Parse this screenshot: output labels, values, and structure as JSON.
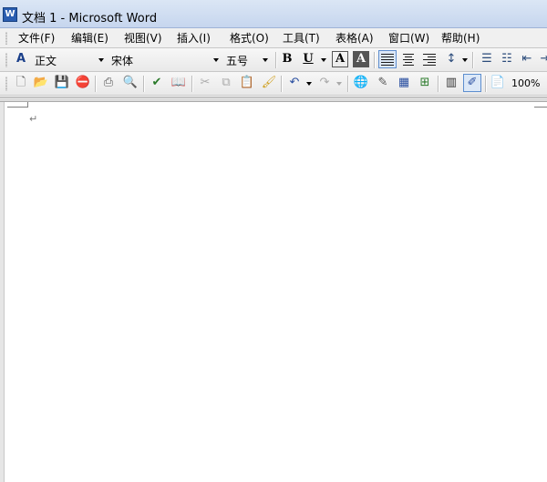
{
  "window": {
    "title": "文档 1 - Microsoft Word",
    "app_icon": "word-doc-icon"
  },
  "menu": {
    "items": [
      {
        "label": "文件(F)"
      },
      {
        "label": "编辑(E)"
      },
      {
        "label": "视图(V)"
      },
      {
        "label": "插入(I)"
      },
      {
        "label": "格式(O)"
      },
      {
        "label": "工具(T)"
      },
      {
        "label": "表格(A)"
      },
      {
        "label": "窗口(W)"
      },
      {
        "label": "帮助(H)"
      }
    ]
  },
  "formatting": {
    "style": "正文",
    "font": "宋体",
    "size": "五号",
    "bold": "B",
    "underline": "U",
    "char_border": "A",
    "char_shading": "A",
    "active_alignment": "justify"
  },
  "standard": {
    "zoom": "100%",
    "icons": [
      "new-document-icon",
      "open-folder-icon",
      "save-icon",
      "permission-icon",
      "print-icon",
      "print-preview-icon",
      "spelling-icon",
      "research-icon",
      "cut-icon",
      "copy-icon",
      "paste-icon",
      "format-painter-icon",
      "undo-icon",
      "redo-icon",
      "hyperlink-icon",
      "drawing-tables-icon",
      "insert-table-icon",
      "insert-excel-icon",
      "columns-icon",
      "drawing-icon",
      "read-icon"
    ]
  },
  "document": {
    "paragraph_mark": "↵"
  }
}
